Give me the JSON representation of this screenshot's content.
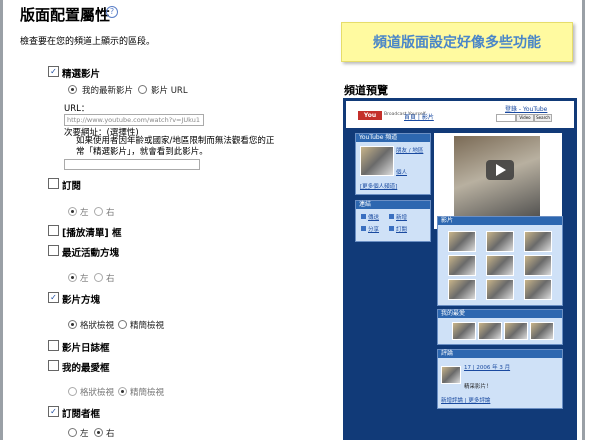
{
  "header": {
    "title": "版面配置屬性",
    "help_icon": "?",
    "description": "檢查要在您的頻道上顯示的區段。"
  },
  "banner": {
    "text": "頻道版面設定好像多些功能"
  },
  "sections": {
    "featured": {
      "label": "精選影片",
      "checked": true,
      "options": [
        "我的最新影片",
        "影片 URL"
      ],
      "url_label": "URL：",
      "url_value": "http://www.youtube.com/watch?v=JUku1",
      "subtitle_label": "次要網址：(選擇性)",
      "note": "如果使用者因年齡或國家/地區限制而無法觀看您的正常「精選影片」，就會看到此影片。"
    },
    "subscribe": {
      "label": "訂閱",
      "checked": false,
      "options": [
        "左",
        "右"
      ]
    },
    "playlists": {
      "label": "[播放清單] 框",
      "checked": false
    },
    "recent_activity": {
      "label": "最近活動方塊",
      "checked": false,
      "options": [
        "左",
        "右"
      ]
    },
    "videos_box": {
      "label": "影片方塊",
      "checked": true,
      "options": [
        "格狀檢視",
        "精簡檢視"
      ]
    },
    "video_log": {
      "label": "影片日誌框",
      "checked": false
    },
    "favorites": {
      "label": "我的最愛框",
      "checked": false,
      "options": [
        "格狀檢視",
        "精簡檢視"
      ]
    },
    "subscribers": {
      "label": "訂閱者框",
      "checked": true,
      "options": [
        "左",
        "右"
      ]
    }
  },
  "preview": {
    "title": "頻道預覽",
    "logo": "You",
    "logo_tagline": "Broadcast Yourself",
    "nav": "首頁 | 影片",
    "top_right": "登錄 - YouTube",
    "btn_video": "Video",
    "btn_search": "Search",
    "channel_head": "YouTube 頻道",
    "channel_lines": [
      "朋友 / 地區",
      "",
      "個人"
    ],
    "channel_link": "[更多個人頻道]",
    "connect_head": "連結",
    "connect_items": [
      "傳送",
      "新增",
      "分享",
      "訂閱"
    ],
    "videos_head": "影片",
    "favorites_head": "我的最愛",
    "comments_head": "評論",
    "comment_date": "17 | 2006 年 3 月",
    "comment_text": "精采影片！",
    "comment_links": "新增評論 | 更多評論"
  }
}
